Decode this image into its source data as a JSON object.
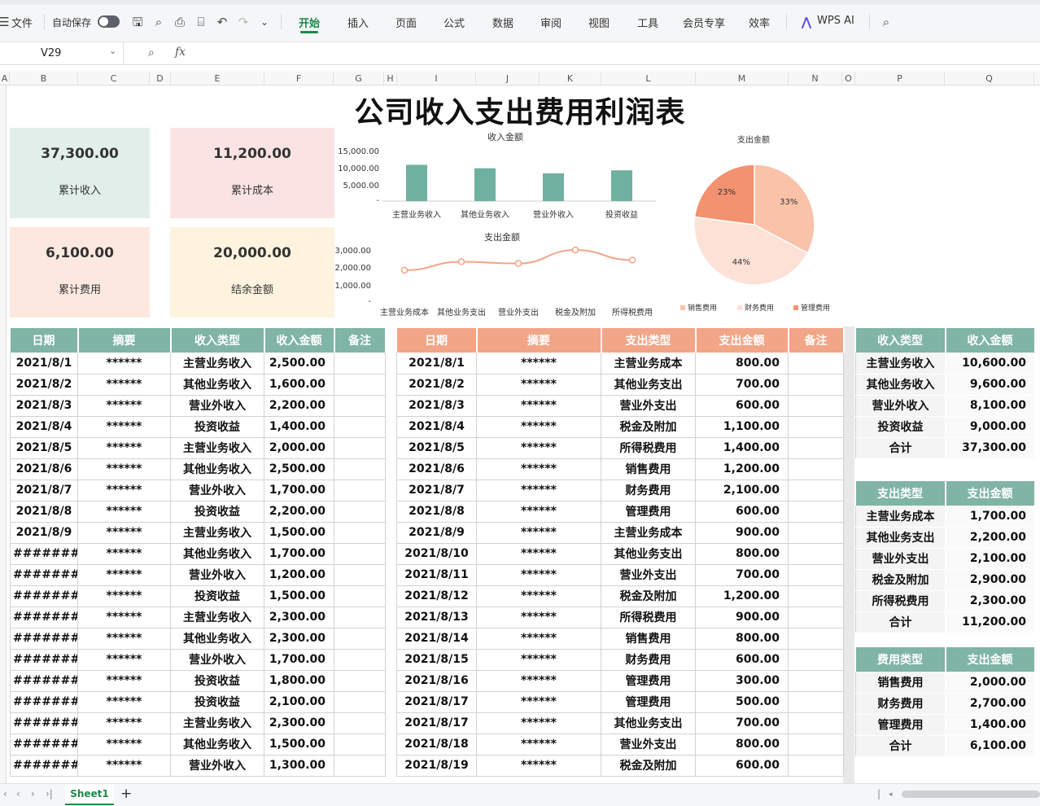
{
  "menubar": {
    "file": "文件",
    "autosave": "自动保存",
    "tabs": [
      "开始",
      "插入",
      "页面",
      "公式",
      "数据",
      "审阅",
      "视图",
      "工具",
      "会员专享",
      "效率"
    ],
    "active_tab": "开始",
    "ai": "WPS AI"
  },
  "formula_bar": {
    "cell_ref": "V29",
    "fx": "fx",
    "content": ""
  },
  "columns": [
    "A",
    "B",
    "C",
    "D",
    "E",
    "F",
    "G",
    "H",
    "I",
    "J",
    "K",
    "L",
    "M",
    "N",
    "O",
    "P",
    "Q"
  ],
  "sheet": {
    "title": "公司收入支出费用利润表",
    "kpis": [
      {
        "value": "37,300.00",
        "label": "累计收入",
        "color": "#e2eee9"
      },
      {
        "value": "11,200.00",
        "label": "累计成本",
        "color": "#fce3e3"
      },
      {
        "value": "6,100.00",
        "label": "累计费用",
        "color": "#fde8df"
      },
      {
        "value": "20,000.00",
        "label": "结余金额",
        "color": "#fdf3df"
      }
    ]
  },
  "chart_data": [
    {
      "type": "bar",
      "title": "收入金额",
      "categories": [
        "主营业务收入",
        "其他业务收入",
        "营业外收入",
        "投资收益"
      ],
      "values": [
        10600,
        9600,
        8100,
        9000
      ],
      "yticks": [
        "15,000.00",
        "10,000.00",
        "5,000.00",
        "-"
      ],
      "ylim": [
        0,
        15000
      ],
      "color": "#6fb1a0"
    },
    {
      "type": "line",
      "title": "支出金额",
      "categories": [
        "主营业务成本",
        "其他业务支出",
        "营业外支出",
        "税金及附加",
        "所得税费用"
      ],
      "values": [
        1700,
        2200,
        2100,
        2900,
        2300
      ],
      "yticks": [
        "3,000.00",
        "2,000.00",
        "1,000.00",
        "-"
      ],
      "ylim": [
        0,
        3000
      ],
      "color": "#f2a587"
    },
    {
      "type": "pie",
      "title": "支出金额",
      "labels": [
        "销售费用",
        "财务费用",
        "管理费用"
      ],
      "values": [
        2000,
        2700,
        1400
      ],
      "percent_labels": [
        "33%",
        "44%",
        "23%"
      ],
      "colors": [
        "#f9c2a9",
        "#fde1d6",
        "#f29270"
      ]
    }
  ],
  "income_table": {
    "headers": [
      "日期",
      "摘要",
      "收入类型",
      "收入金额",
      "备注"
    ],
    "rows": [
      [
        "2021/8/1",
        "******",
        "主营业务收入",
        "2,500.00",
        ""
      ],
      [
        "2021/8/2",
        "******",
        "其他业务收入",
        "1,600.00",
        ""
      ],
      [
        "2021/8/3",
        "******",
        "营业外收入",
        "2,200.00",
        ""
      ],
      [
        "2021/8/4",
        "******",
        "投资收益",
        "1,400.00",
        ""
      ],
      [
        "2021/8/5",
        "******",
        "主营业务收入",
        "2,000.00",
        ""
      ],
      [
        "2021/8/6",
        "******",
        "其他业务收入",
        "2,500.00",
        ""
      ],
      [
        "2021/8/7",
        "******",
        "营业外收入",
        "1,700.00",
        ""
      ],
      [
        "2021/8/8",
        "******",
        "投资收益",
        "2,200.00",
        ""
      ],
      [
        "2021/8/9",
        "******",
        "主营业务收入",
        "1,500.00",
        ""
      ],
      [
        "########",
        "******",
        "其他业务收入",
        "1,700.00",
        ""
      ],
      [
        "########",
        "******",
        "营业外收入",
        "1,200.00",
        ""
      ],
      [
        "########",
        "******",
        "投资收益",
        "1,500.00",
        ""
      ],
      [
        "########",
        "******",
        "主营业务收入",
        "2,300.00",
        ""
      ],
      [
        "########",
        "******",
        "其他业务收入",
        "2,300.00",
        ""
      ],
      [
        "########",
        "******",
        "营业外收入",
        "1,700.00",
        ""
      ],
      [
        "########",
        "******",
        "投资收益",
        "1,800.00",
        ""
      ],
      [
        "########",
        "******",
        "投资收益",
        "2,100.00",
        ""
      ],
      [
        "########",
        "******",
        "主营业务收入",
        "2,300.00",
        ""
      ],
      [
        "########",
        "******",
        "其他业务收入",
        "1,500.00",
        ""
      ],
      [
        "########",
        "******",
        "营业外收入",
        "1,300.00",
        ""
      ]
    ]
  },
  "expense_table": {
    "headers": [
      "日期",
      "摘要",
      "支出类型",
      "支出金额",
      "备注"
    ],
    "rows": [
      [
        "2021/8/1",
        "******",
        "主营业务成本",
        "800.00",
        ""
      ],
      [
        "2021/8/2",
        "******",
        "其他业务支出",
        "700.00",
        ""
      ],
      [
        "2021/8/3",
        "******",
        "营业外支出",
        "600.00",
        ""
      ],
      [
        "2021/8/4",
        "******",
        "税金及附加",
        "1,100.00",
        ""
      ],
      [
        "2021/8/5",
        "******",
        "所得税费用",
        "1,400.00",
        ""
      ],
      [
        "2021/8/6",
        "******",
        "销售费用",
        "1,200.00",
        ""
      ],
      [
        "2021/8/7",
        "******",
        "财务费用",
        "2,100.00",
        ""
      ],
      [
        "2021/8/8",
        "******",
        "管理费用",
        "600.00",
        ""
      ],
      [
        "2021/8/9",
        "******",
        "主营业务成本",
        "900.00",
        ""
      ],
      [
        "2021/8/10",
        "******",
        "其他业务支出",
        "800.00",
        ""
      ],
      [
        "2021/8/11",
        "******",
        "营业外支出",
        "700.00",
        ""
      ],
      [
        "2021/8/12",
        "******",
        "税金及附加",
        "1,200.00",
        ""
      ],
      [
        "2021/8/13",
        "******",
        "所得税费用",
        "900.00",
        ""
      ],
      [
        "2021/8/14",
        "******",
        "销售费用",
        "800.00",
        ""
      ],
      [
        "2021/8/15",
        "******",
        "财务费用",
        "600.00",
        ""
      ],
      [
        "2021/8/16",
        "******",
        "管理费用",
        "300.00",
        ""
      ],
      [
        "2021/8/17",
        "******",
        "管理费用",
        "500.00",
        ""
      ],
      [
        "2021/8/17",
        "******",
        "其他业务支出",
        "700.00",
        ""
      ],
      [
        "2021/8/18",
        "******",
        "营业外支出",
        "800.00",
        ""
      ],
      [
        "2021/8/19",
        "******",
        "税金及附加",
        "600.00",
        ""
      ]
    ]
  },
  "summary_income": {
    "headers": [
      "收入类型",
      "收入金额"
    ],
    "rows": [
      [
        "主营业务收入",
        "10,600.00"
      ],
      [
        "其他业务收入",
        "9,600.00"
      ],
      [
        "营业外收入",
        "8,100.00"
      ],
      [
        "投资收益",
        "9,000.00"
      ],
      [
        "合计",
        "37,300.00"
      ]
    ]
  },
  "summary_expense": {
    "headers": [
      "支出类型",
      "支出金额"
    ],
    "rows": [
      [
        "主营业务成本",
        "1,700.00"
      ],
      [
        "其他业务支出",
        "2,200.00"
      ],
      [
        "营业外支出",
        "2,100.00"
      ],
      [
        "税金及附加",
        "2,900.00"
      ],
      [
        "所得税费用",
        "2,300.00"
      ],
      [
        "合计",
        "11,200.00"
      ]
    ]
  },
  "summary_fee": {
    "headers": [
      "费用类型",
      "支出金额"
    ],
    "rows": [
      [
        "销售费用",
        "2,000.00"
      ],
      [
        "财务费用",
        "2,700.00"
      ],
      [
        "管理费用",
        "1,400.00"
      ],
      [
        "合计",
        "6,100.00"
      ]
    ]
  },
  "bottombar": {
    "sheet_tab": "Sheet1",
    "add": "+"
  },
  "colors": {
    "accent": "#1c8a4a",
    "green_header": "#7fb4a6",
    "orange_header": "#f2a587"
  }
}
